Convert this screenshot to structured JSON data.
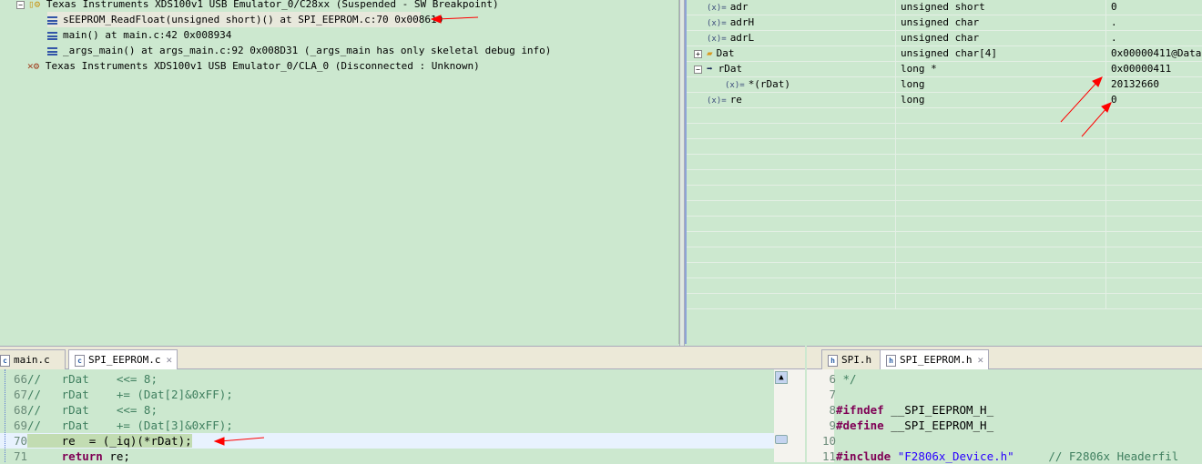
{
  "debug": {
    "target1": "Texas Instruments XDS100v1 USB Emulator_0/C28xx (Suspended - SW Breakpoint)",
    "frames": [
      "sEEPROM_ReadFloat(unsigned short)() at SPI_EEPROM.c:70 0x008610",
      "main() at main.c:42 0x008934",
      "_args_main() at args_main.c:92 0x008D31  (_args_main has only skeletal debug info)"
    ],
    "target2": "Texas Instruments XDS100v1 USB Emulator_0/CLA_0 (Disconnected : Unknown)"
  },
  "variables": [
    {
      "name": "adr",
      "type": "unsigned short",
      "value": "0",
      "icon": "variable-icon"
    },
    {
      "name": "adrH",
      "type": "unsigned char",
      "value": ".",
      "icon": "variable-icon"
    },
    {
      "name": "adrL",
      "type": "unsigned char",
      "value": ".",
      "icon": "variable-icon"
    },
    {
      "name": "Dat",
      "type": "unsigned char[4]",
      "value": "0x00000411@Data",
      "icon": "array-icon",
      "expand": "+"
    },
    {
      "name": "rDat",
      "type": "long *",
      "value": "0x00000411",
      "icon": "pointer-icon",
      "expand": "−"
    },
    {
      "name": "*(rDat)",
      "type": "long",
      "value": "20132660",
      "icon": "variable-icon"
    },
    {
      "name": "re",
      "type": "long",
      "value": "0",
      "icon": "variable-icon"
    }
  ],
  "var_icon_text": "(x)=",
  "editor_left": {
    "tabs": [
      "main.c",
      "SPI_EEPROM.c"
    ],
    "lines": [
      {
        "n": "66",
        "code": "//   rDat    <<= 8;"
      },
      {
        "n": "67",
        "code": "//   rDat    += (Dat[2]&0xFF);"
      },
      {
        "n": "68",
        "code": "//   rDat    <<= 8;"
      },
      {
        "n": "69",
        "code": "//   rDat    += (Dat[3]&0xFF);"
      },
      {
        "n": "70",
        "code": "     re  = (_iq)(*rDat);"
      },
      {
        "n": "71",
        "kw": "return",
        "code": " re;"
      }
    ]
  },
  "editor_right": {
    "tabs": [
      "SPI.h",
      "SPI_EEPROM.h"
    ],
    "lines": [
      {
        "n": "6",
        "code": " */"
      },
      {
        "n": "7",
        "code": ""
      },
      {
        "n": "8",
        "kw": "#ifndef",
        "code": " __SPI_EEPROM_H_"
      },
      {
        "n": "9",
        "kw": "#define",
        "code": " __SPI_EEPROM_H_"
      },
      {
        "n": "10",
        "code": ""
      },
      {
        "n": "11",
        "kw": "#include",
        "str": " \"F2806x_Device.h\"",
        "cm": "     // F2806x Headerfil"
      }
    ]
  }
}
